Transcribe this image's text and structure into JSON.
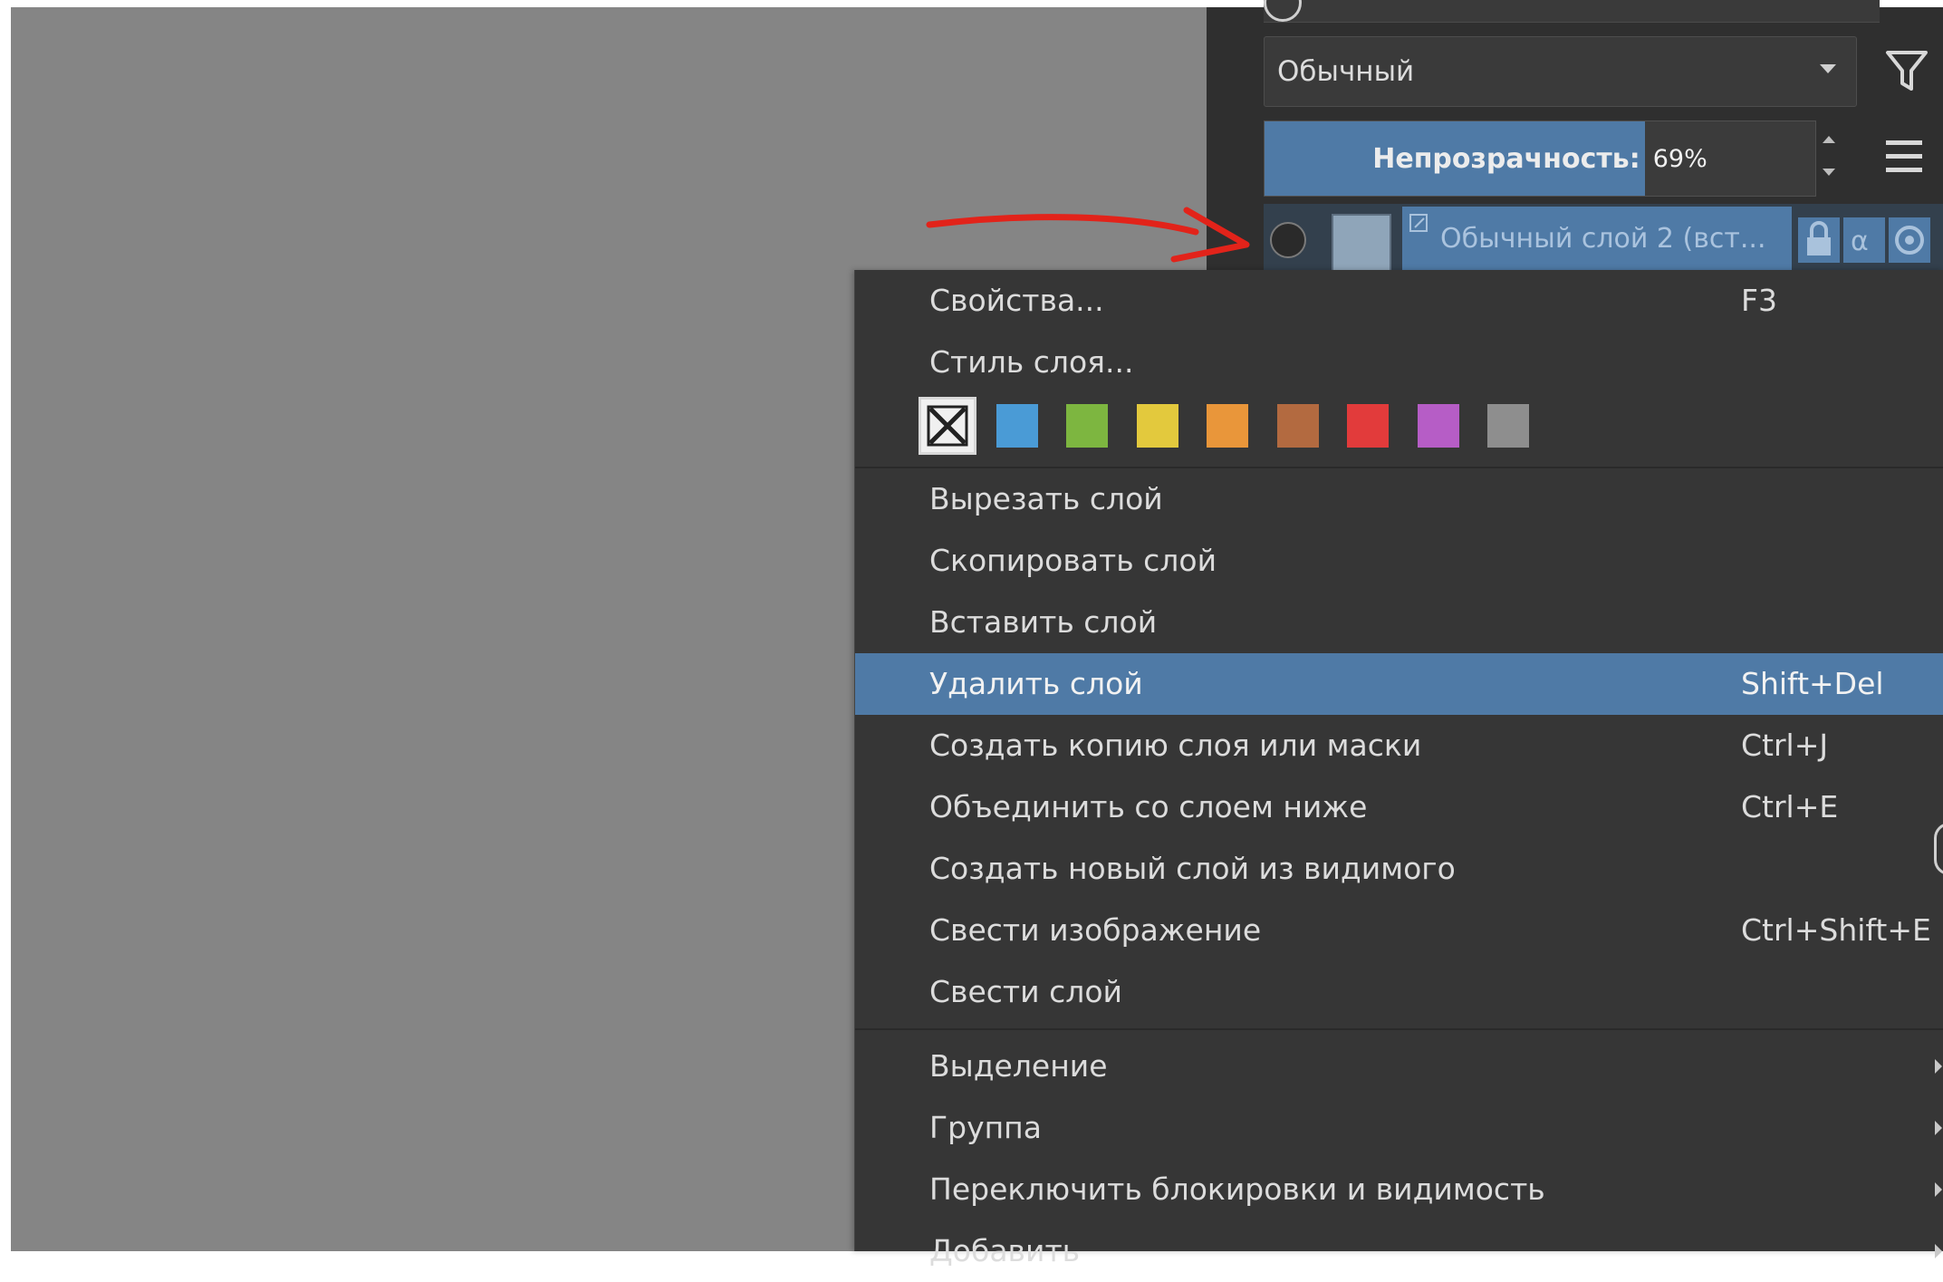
{
  "colors": {
    "canvas_bg": "#858585",
    "panel_bg": "#2f2f2f",
    "menu_bg": "#363636",
    "accent": "#4f7aa6",
    "arrow": "#e2231a"
  },
  "layers_panel": {
    "blend_mode": "Обычный",
    "opacity_label": "Непрозрачность:",
    "opacity_value": "69%",
    "opacity_fraction": 0.69,
    "layer_name": "Обычный слой 2 (вст..."
  },
  "context_menu": {
    "items_top": [
      {
        "label": "Свойства...",
        "shortcut": "F3"
      },
      {
        "label": "Стиль слоя...",
        "shortcut": ""
      }
    ],
    "color_labels": [
      {
        "name": "none-label-icon",
        "color": "none"
      },
      {
        "name": "blue",
        "color": "#4a9bd6"
      },
      {
        "name": "green",
        "color": "#7db640"
      },
      {
        "name": "yellow",
        "color": "#e3c93d"
      },
      {
        "name": "orange",
        "color": "#e9963a"
      },
      {
        "name": "brown",
        "color": "#b36a40"
      },
      {
        "name": "red",
        "color": "#e23b3b"
      },
      {
        "name": "purple",
        "color": "#b65dc6"
      },
      {
        "name": "gray",
        "color": "#8e8e8e"
      }
    ],
    "items_clipboard": [
      {
        "label": "Вырезать слой",
        "shortcut": ""
      },
      {
        "label": "Скопировать слой",
        "shortcut": ""
      },
      {
        "label": "Вставить слой",
        "shortcut": ""
      },
      {
        "label": "Удалить слой",
        "shortcut": "Shift+Del",
        "highlight": true
      },
      {
        "label": "Создать копию слоя или маски",
        "shortcut": "Ctrl+J"
      },
      {
        "label": "Объединить со слоем ниже",
        "shortcut": "Ctrl+E"
      },
      {
        "label": "Создать новый слой из видимого",
        "shortcut": ""
      },
      {
        "label": "Свести изображение",
        "shortcut": "Ctrl+Shift+E"
      },
      {
        "label": "Свести слой",
        "shortcut": ""
      }
    ],
    "items_submenus": [
      {
        "label": "Выделение"
      },
      {
        "label": "Группа"
      },
      {
        "label": "Переключить блокировки и видимость"
      },
      {
        "label": "Добавить"
      }
    ]
  }
}
